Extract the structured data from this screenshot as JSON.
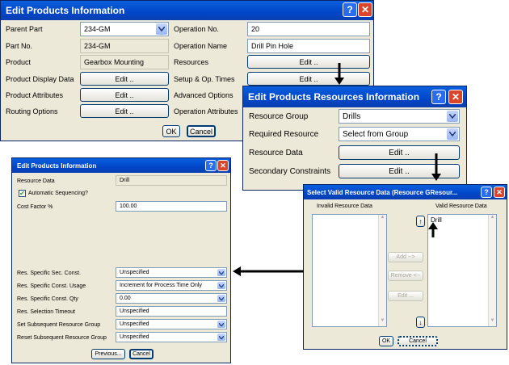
{
  "w1": {
    "title": "Edit Products Information",
    "parent_part_label": "Parent Part",
    "parent_part_value": "234-GM",
    "part_no_label": "Part No.",
    "part_no_value": "234-GM",
    "product_label": "Product",
    "product_value": "Gearbox Mounting",
    "display_data_label": "Product Display Data",
    "attributes_label": "Product Attributes",
    "routing_label": "Routing Options",
    "operation_no_label": "Operation No.",
    "operation_no_value": "20",
    "operation_name_label": "Operation Name",
    "operation_name_value": "Drill Pin Hole",
    "resources_label": "Resources",
    "setup_label": "Setup & Op. Times",
    "advanced_label": "Advanced Options",
    "op_attr_label": "Operation Attributes",
    "edit": "Edit ..",
    "ok": "OK",
    "cancel": "Cancel"
  },
  "w2": {
    "title": "Edit Products Resources  Information",
    "group_label": "Resource Group",
    "group_value": "Drills",
    "required_label": "Required Resource",
    "required_value": "Select from Group",
    "data_label": "Resource Data",
    "secondary_label": "Secondary Constraints",
    "edit": "Edit .."
  },
  "w3": {
    "title": "Edit Products Information",
    "resource_data_label": "Resource Data",
    "resource_data_value": "Drill",
    "auto_seq_label": "Automatic Sequencing?",
    "auto_seq_checked": true,
    "cost_factor_label": "Cost Factor %",
    "cost_factor_value": "100.00",
    "sec_const_label": "Res. Specific Sec. Const.",
    "sec_const_value": "Unspecified",
    "const_usage_label": "Res. Specific Const. Usage",
    "const_usage_value": "Increment for Process Time Only",
    "const_qty_label": "Res. Specific Const. Qty",
    "const_qty_value": "0.00",
    "timeout_label": "Res. Selection Timeout",
    "timeout_value": "Unspecified",
    "set_group_label": "Set Subsequent Resource Group",
    "set_group_value": "Unspecified",
    "reset_group_label": "Reset Subsequent Resource Group",
    "reset_group_value": "Unspecified",
    "previous": "Previous...",
    "cancel": "Cancel"
  },
  "w4": {
    "title": "Select Valid Resource Data (Resource GResour...",
    "invalid_label": "Invalid Resource Data",
    "valid_label": "Valid Resource Data",
    "valid_items": [
      "Drill"
    ],
    "add": "Add -->",
    "remove": "Remove <--",
    "edit": "Edit ...",
    "ok": "OK",
    "cancel": "Cancel"
  }
}
